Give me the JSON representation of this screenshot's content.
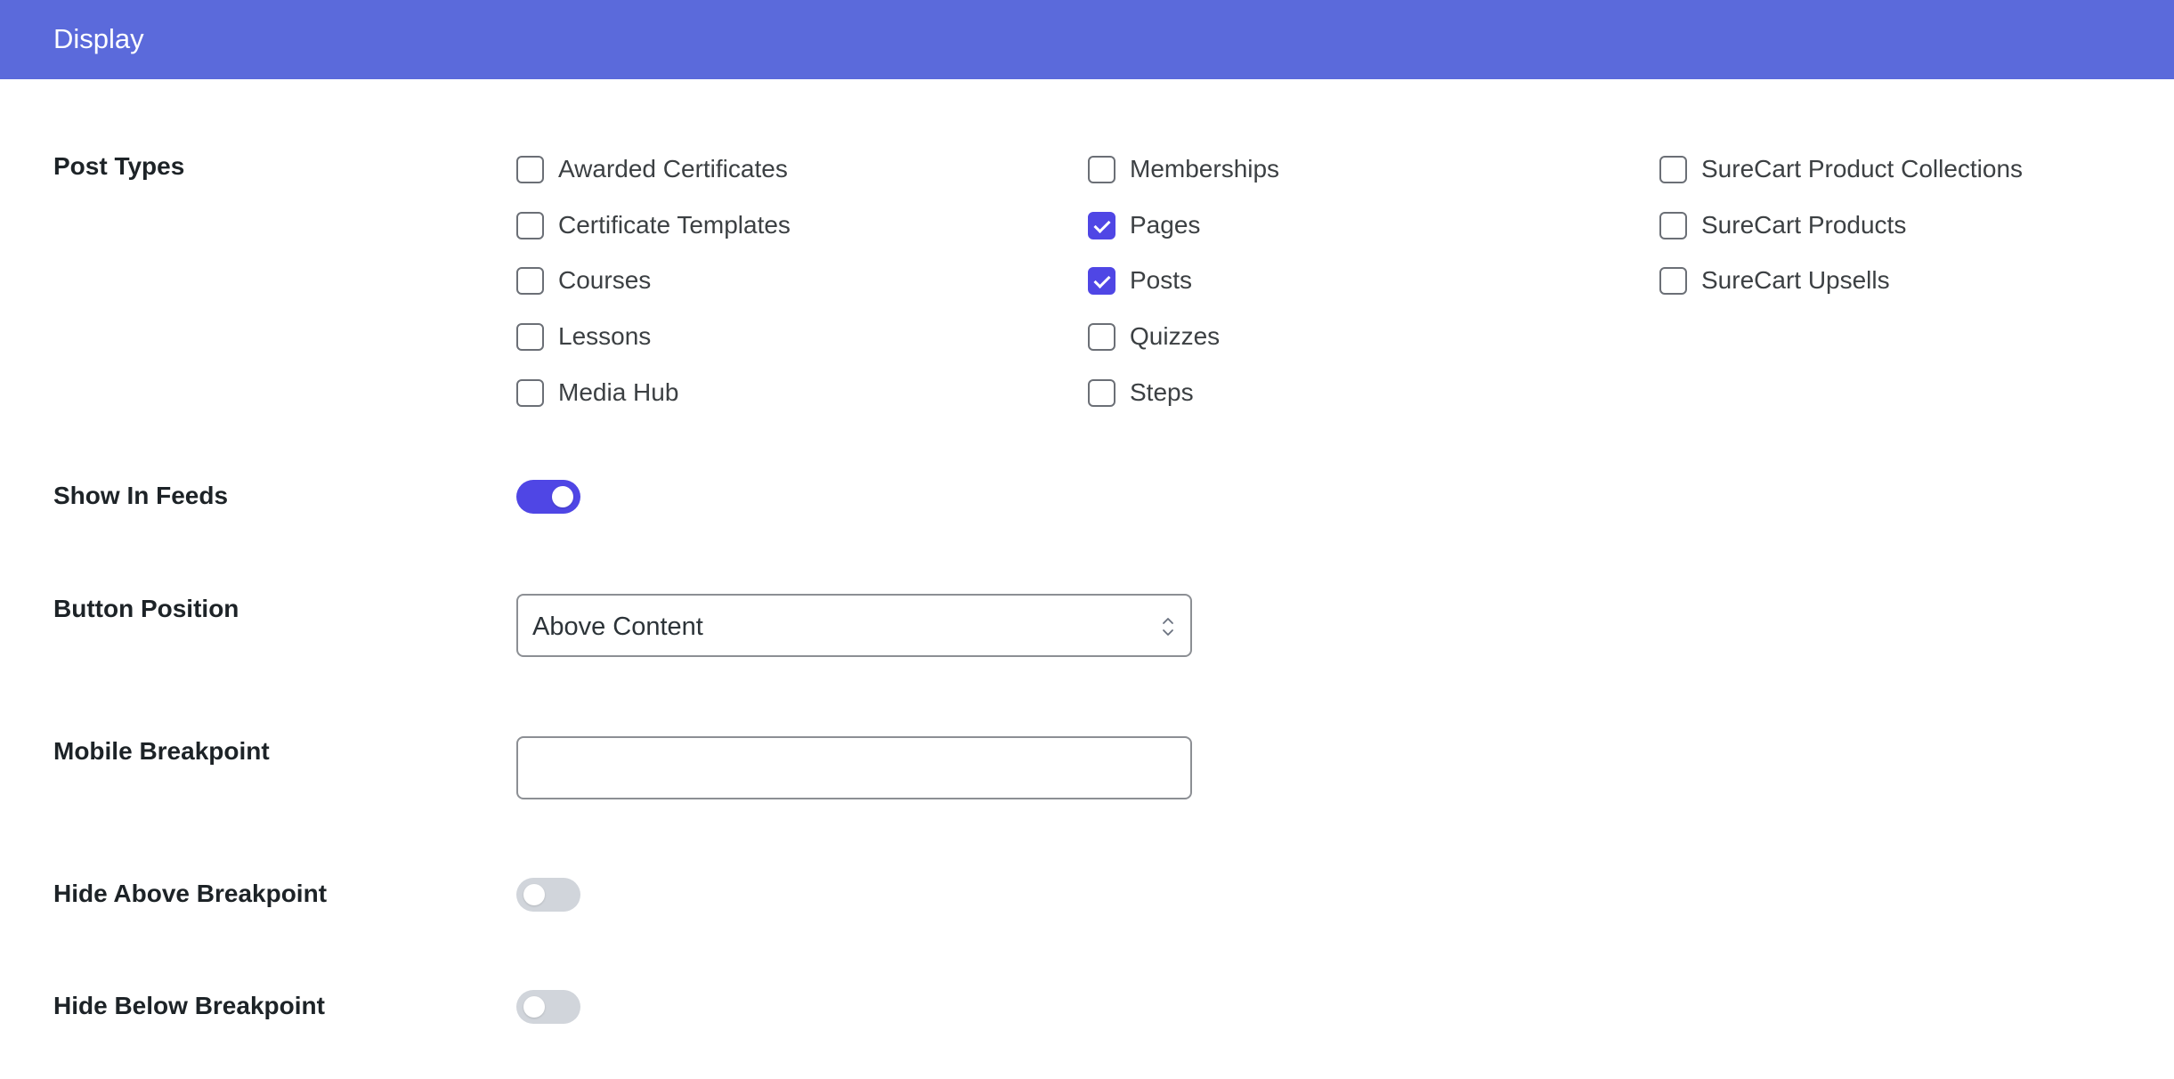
{
  "header": {
    "title": "Display"
  },
  "post_types": {
    "label": "Post Types",
    "columns": [
      [
        {
          "label": "Awarded Certificates",
          "checked": false
        },
        {
          "label": "Certificate Templates",
          "checked": false
        },
        {
          "label": "Courses",
          "checked": false
        },
        {
          "label": "Lessons",
          "checked": false
        },
        {
          "label": "Media Hub",
          "checked": false
        }
      ],
      [
        {
          "label": "Memberships",
          "checked": false
        },
        {
          "label": "Pages",
          "checked": true
        },
        {
          "label": "Posts",
          "checked": true
        },
        {
          "label": "Quizzes",
          "checked": false
        },
        {
          "label": "Steps",
          "checked": false
        }
      ],
      [
        {
          "label": "SureCart Product Collections",
          "checked": false
        },
        {
          "label": "SureCart Products",
          "checked": false
        },
        {
          "label": "SureCart Upsells",
          "checked": false
        }
      ]
    ]
  },
  "show_in_feeds": {
    "label": "Show In Feeds",
    "on": true
  },
  "button_position": {
    "label": "Button Position",
    "value": "Above Content"
  },
  "mobile_breakpoint": {
    "label": "Mobile Breakpoint",
    "value": ""
  },
  "hide_above_breakpoint": {
    "label": "Hide Above Breakpoint",
    "on": false
  },
  "hide_below_breakpoint": {
    "label": "Hide Below Breakpoint",
    "on": false
  },
  "colors": {
    "header_bg": "#5b6adb",
    "accent": "#4f46e5",
    "toggle_off": "#d1d5db"
  }
}
